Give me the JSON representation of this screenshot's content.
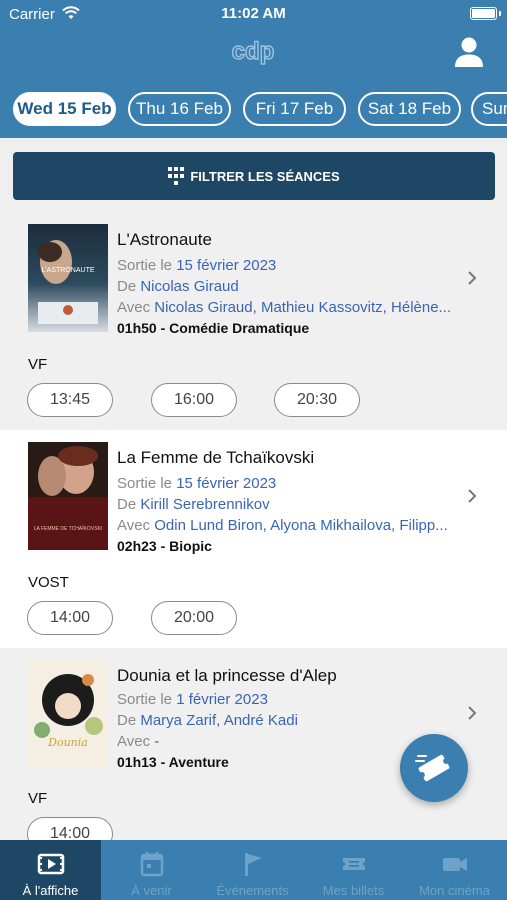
{
  "status_bar": {
    "carrier": "Carrier",
    "time": "11:02 AM"
  },
  "header": {
    "logo_text": "cdp"
  },
  "dates": [
    {
      "label": "Wed 15 Feb",
      "active": true
    },
    {
      "label": "Thu 16 Feb",
      "active": false
    },
    {
      "label": "Fri 17 Feb",
      "active": false
    },
    {
      "label": "Sat 18 Feb",
      "active": false
    },
    {
      "label": "Sun",
      "active": false
    }
  ],
  "filter": {
    "label": "FILTRER LES SÉANCES"
  },
  "films": [
    {
      "title": "L'Astronaute",
      "release_prefix": "Sortie le ",
      "release_date": "15 février 2023",
      "director_prefix": "De ",
      "director": "Nicolas Giraud",
      "cast_prefix": "Avec ",
      "cast": "Nicolas Giraud, Mathieu Kassovitz, Hélène...",
      "duration": "01h50",
      "genre": "Comédie Dramatique",
      "language": "VF",
      "times": [
        "13:45",
        "16:00",
        "20:30"
      ],
      "poster_text": "L'ASTRONAUTE"
    },
    {
      "title": "La Femme de Tchaïkovski",
      "release_prefix": "Sortie le ",
      "release_date": "15 février 2023",
      "director_prefix": "De ",
      "director": "Kirill Serebrennikov",
      "cast_prefix": "Avec ",
      "cast": "Odin Lund Biron, Alyona Mikhailova, Filipp...",
      "duration": "02h23",
      "genre": "Biopic",
      "language": "VOST",
      "times": [
        "14:00",
        "20:00"
      ],
      "poster_text": "LA FEMME DE TCHAÏKOVSKI"
    },
    {
      "title": "Dounia et la princesse d'Alep",
      "release_prefix": "Sortie le ",
      "release_date": "1 février 2023",
      "director_prefix": "De ",
      "director": "Marya Zarif, André Kadi",
      "cast_prefix": "Avec ",
      "cast": "-",
      "duration": "01h13",
      "genre": "Aventure",
      "language": "VF",
      "times": [
        "14:00"
      ],
      "poster_text": "Dounia"
    }
  ],
  "meta_separator": " - ",
  "tabs": [
    {
      "label": "À l'affiche",
      "icon": "film-icon",
      "active": true
    },
    {
      "label": "À venir",
      "icon": "calendar-icon",
      "active": false
    },
    {
      "label": "Événements",
      "icon": "flag-icon",
      "active": false
    },
    {
      "label": "Mes billets",
      "icon": "ticket-icon",
      "active": false
    },
    {
      "label": "Mon cinéma",
      "icon": "camera-icon",
      "active": false
    }
  ],
  "colors": {
    "brand": "#3a7fb0",
    "dark": "#1d4764",
    "link": "#3a65b5"
  }
}
